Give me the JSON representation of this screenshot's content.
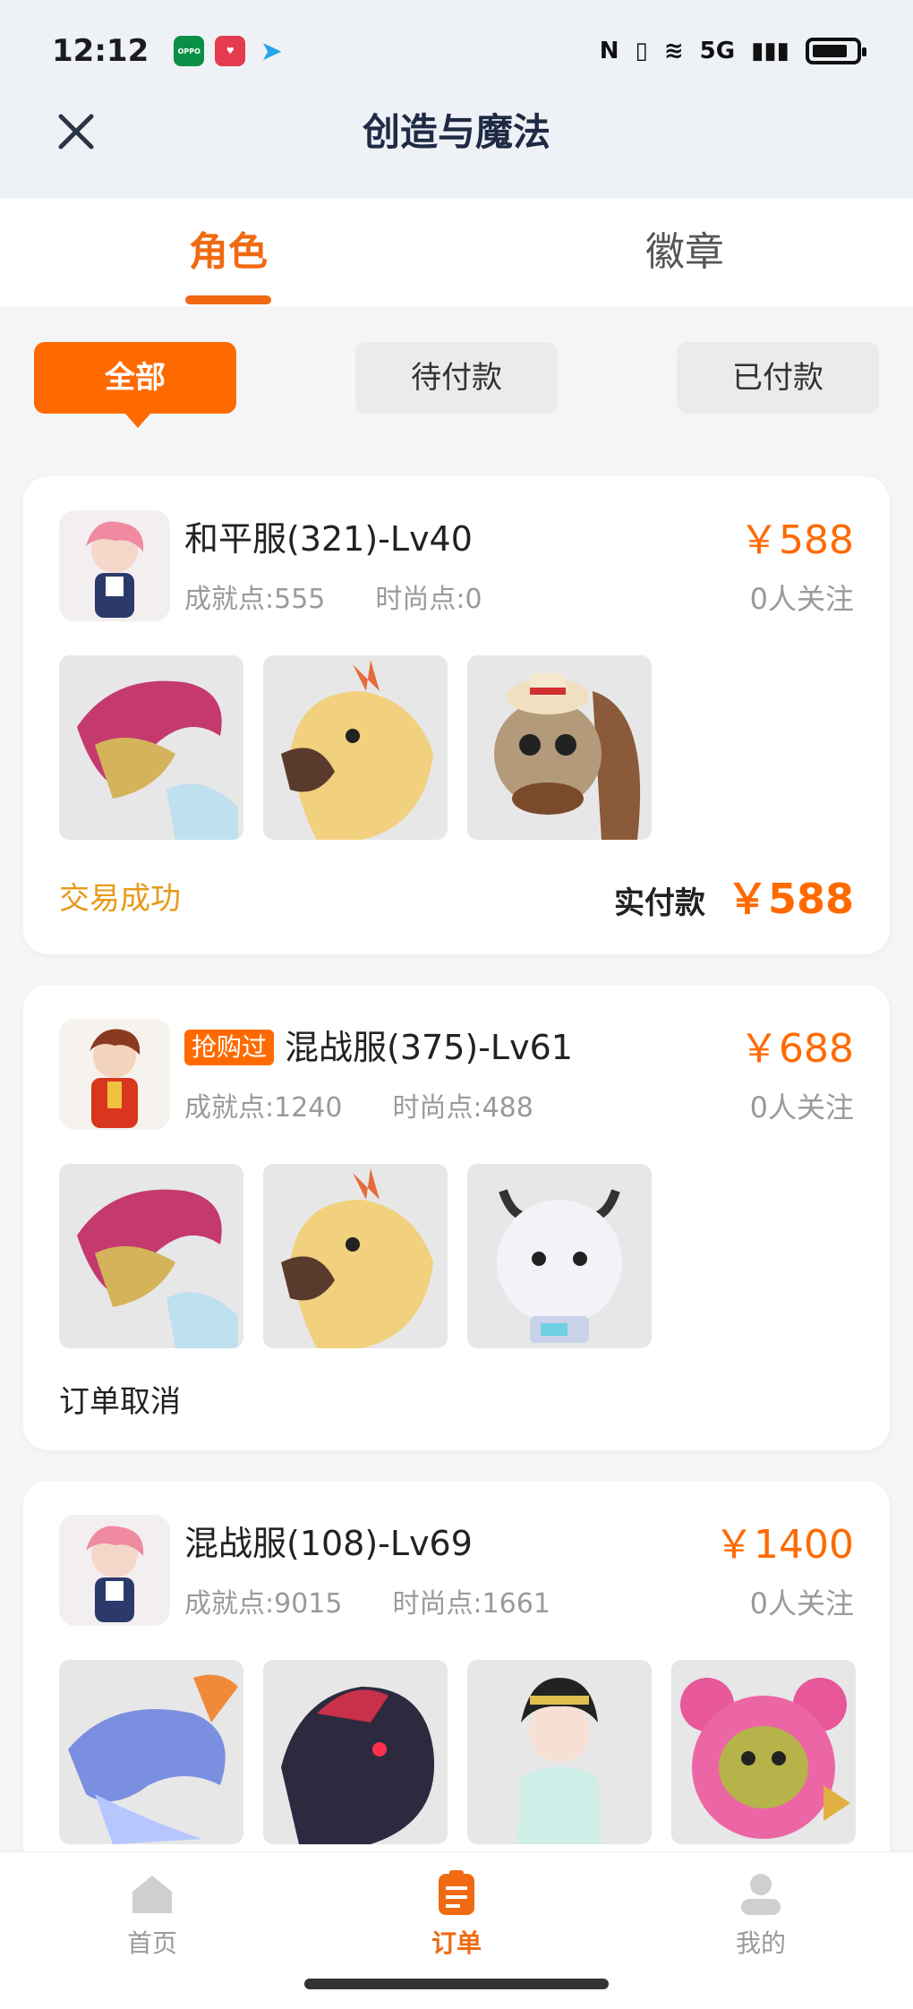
{
  "statusbar": {
    "time": "12:12",
    "network": "5G",
    "app_icon_oppo_text": "OPPO"
  },
  "header": {
    "title": "创造与魔法"
  },
  "tabs": [
    {
      "label": "角色",
      "active": true
    },
    {
      "label": "徽章",
      "active": false
    }
  ],
  "filters": [
    {
      "label": "全部",
      "active": true
    },
    {
      "label": "待付款",
      "active": false
    },
    {
      "label": "已付款",
      "active": false
    }
  ],
  "orders": [
    {
      "tag": "",
      "title": "和平服(321)-Lv40",
      "achievement": "成就点:555",
      "fashion": "时尚点:0",
      "price": "￥588",
      "followers": "0人关注",
      "item_icons": [
        "dragon-red",
        "phoenix-yellow",
        "squirrel-hat"
      ],
      "status": "交易成功",
      "status_color": "#e69a1a",
      "paid_label": "实付款",
      "paid_amount": "￥588"
    },
    {
      "tag": "抢购过",
      "title": "混战服(375)-Lv61",
      "achievement": "成就点:1240",
      "fashion": "时尚点:488",
      "price": "￥688",
      "followers": "0人关注",
      "item_icons": [
        "dragon-red",
        "phoenix-yellow",
        "cow-robot"
      ],
      "status": "订单取消",
      "status_color": "#222222",
      "paid_label": "",
      "paid_amount": ""
    },
    {
      "tag": "",
      "title": "混战服(108)-Lv69",
      "achievement": "成就点:9015",
      "fashion": "时尚点:1661",
      "price": "￥1400",
      "followers": "0人关注",
      "item_icons": [
        "dragon-blue",
        "dragon-black",
        "girl-costume",
        "pink-bear"
      ],
      "status": "",
      "status_color": "#222222",
      "paid_label": "",
      "paid_amount": ""
    }
  ],
  "bottom_nav": [
    {
      "label": "首页",
      "icon": "home-icon",
      "active": false
    },
    {
      "label": "订单",
      "icon": "order-icon",
      "active": true
    },
    {
      "label": "我的",
      "icon": "profile-icon",
      "active": false
    }
  ],
  "colors": {
    "accent": "#ff6a00",
    "success": "#e69a1a"
  }
}
